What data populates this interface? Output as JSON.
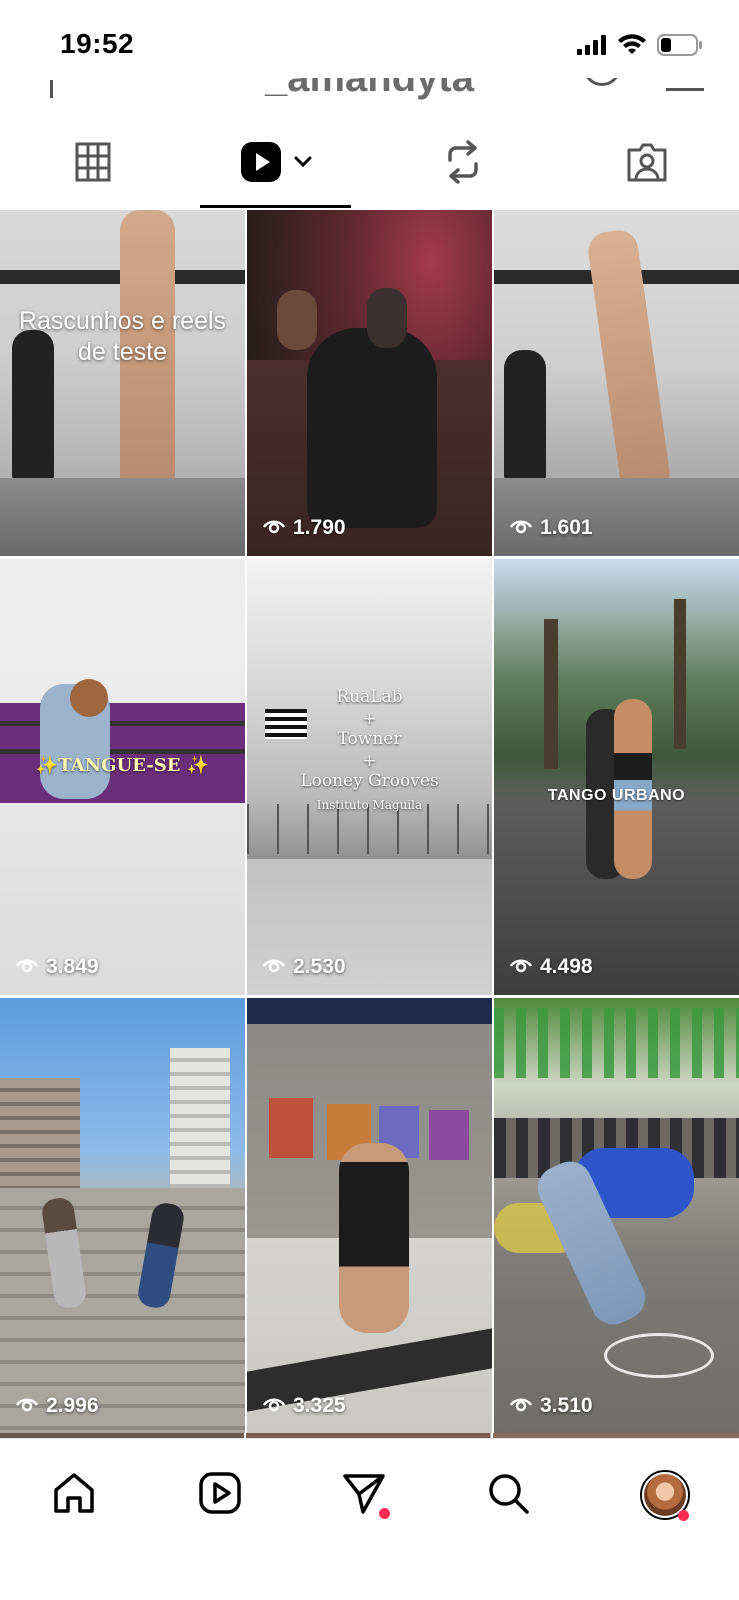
{
  "status_bar": {
    "time": "19:52"
  },
  "profile": {
    "username": "_amandyta"
  },
  "tabs": [
    {
      "name": "grid",
      "icon": "grid-icon",
      "active": false
    },
    {
      "name": "reels",
      "icon": "reels-icon",
      "active": true
    },
    {
      "name": "reposts",
      "icon": "repost-icon",
      "active": false
    },
    {
      "name": "tagged",
      "icon": "tagged-icon",
      "active": false
    }
  ],
  "reels": [
    {
      "overlay_title": "Rascunhos e reels de teste",
      "views": ""
    },
    {
      "overlay_title": "",
      "views": "1.790"
    },
    {
      "overlay_title": "",
      "views": "1.601"
    },
    {
      "overlay_title": "✨TANGUE-SE ✨",
      "views": "3.849"
    },
    {
      "overlay_title": "RuaLab + Towner + Looney Grooves",
      "overlay_subtitle": "Instituto Maguila",
      "views": "2.530"
    },
    {
      "overlay_title": "TANGO URBANO",
      "views": "4.498"
    },
    {
      "overlay_title": "",
      "views": "2.996"
    },
    {
      "overlay_title": "",
      "views": "3.325"
    },
    {
      "overlay_title": "",
      "views": "3.510"
    }
  ],
  "rualab_lines": [
    "RuaLab",
    "+",
    "Towner",
    "+",
    "Looney Grooves",
    "Instituto Maguila"
  ],
  "bottom_nav": [
    {
      "name": "home",
      "icon": "home-icon"
    },
    {
      "name": "reels",
      "icon": "reels-nav-icon"
    },
    {
      "name": "messages",
      "icon": "send-icon",
      "notification": true
    },
    {
      "name": "search",
      "icon": "search-icon"
    },
    {
      "name": "profile",
      "icon": "avatar",
      "notification": true
    }
  ],
  "colors": {
    "notification_dot": "#ff2d55",
    "active_tab_indicator": "#000000"
  }
}
